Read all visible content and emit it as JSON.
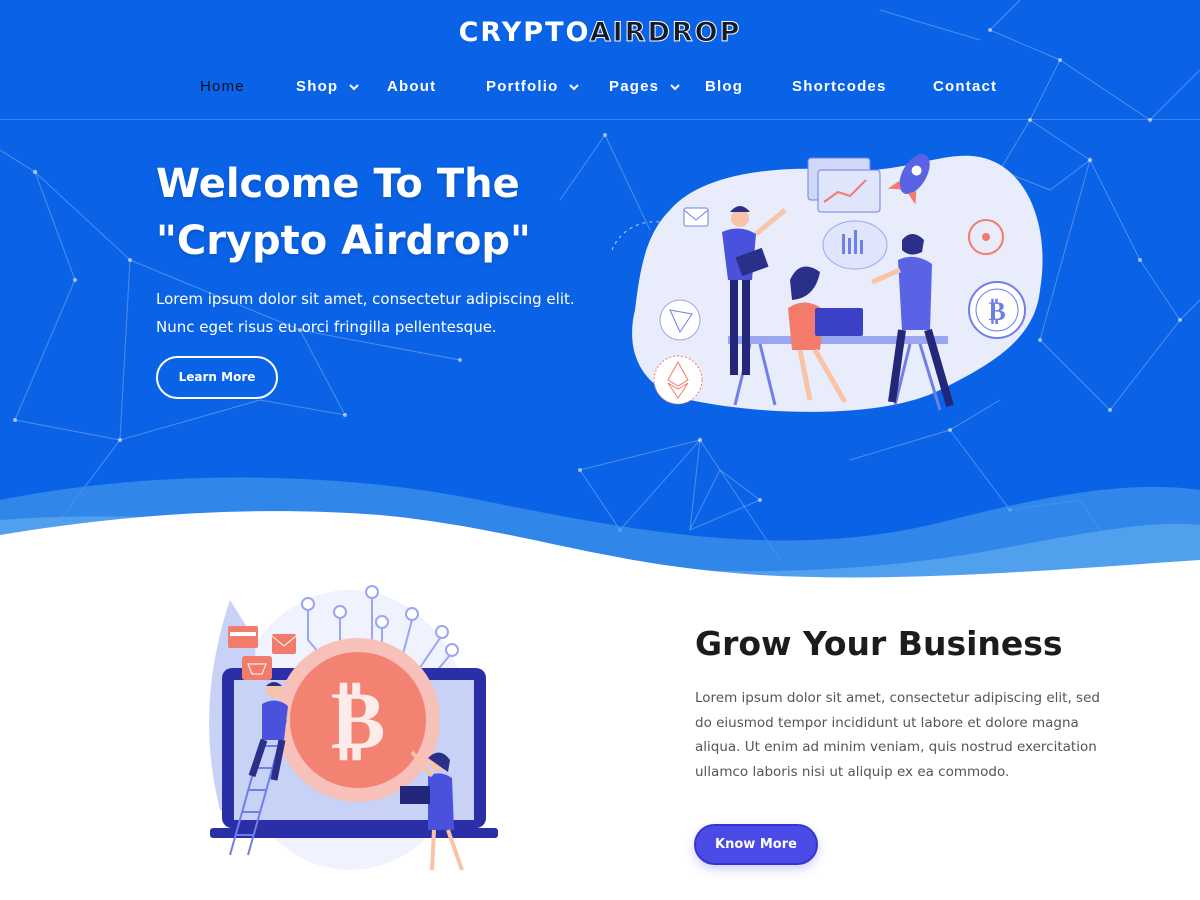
{
  "brand": {
    "logo_part1": "CRYPTO",
    "logo_part2": "AIRDROP"
  },
  "nav": {
    "items": [
      {
        "label": "Home",
        "active": true,
        "dropdown": false
      },
      {
        "label": "Shop",
        "active": false,
        "dropdown": true
      },
      {
        "label": "About",
        "active": false,
        "dropdown": false
      },
      {
        "label": "Portfolio",
        "active": false,
        "dropdown": true
      },
      {
        "label": "Pages",
        "active": false,
        "dropdown": true
      },
      {
        "label": "Blog",
        "active": false,
        "dropdown": false
      },
      {
        "label": "Shortcodes",
        "active": false,
        "dropdown": false
      },
      {
        "label": "Contact",
        "active": false,
        "dropdown": false
      }
    ]
  },
  "hero": {
    "title_line1": "Welcome To The",
    "title_line2": "\"Crypto Airdrop\"",
    "text_line1": "Lorem ipsum dolor sit amet, consectetur adipiscing elit.",
    "text_line2": "Nunc eget risus eu orci fringilla pellentesque.",
    "button_label": "Learn More"
  },
  "feature": {
    "title": "Grow Your Business",
    "text_line1": "Lorem ipsum dolor sit amet, consectetur adipiscing elit, sed",
    "text_line2": "do eiusmod tempor incididunt ut labore et dolore magna",
    "text_line3": "aliqua. Ut enim ad minim veniam, quis nostrud exercitation",
    "text_line4": "ullamco laboris nisi ut aliquip ex ea commodo.",
    "button_label": "Know More"
  },
  "icons": [
    "chevron-down-icon",
    "bitcoin-icon",
    "ethereum-icon",
    "ripple-icon",
    "tron-icon",
    "rocket-icon",
    "mail-icon",
    "cart-icon"
  ],
  "colors": {
    "hero_bg": "#0a63e6",
    "accent_button": "#4a4ae6",
    "coin": "#f27b6b",
    "text_dark": "#1c1c1c"
  }
}
